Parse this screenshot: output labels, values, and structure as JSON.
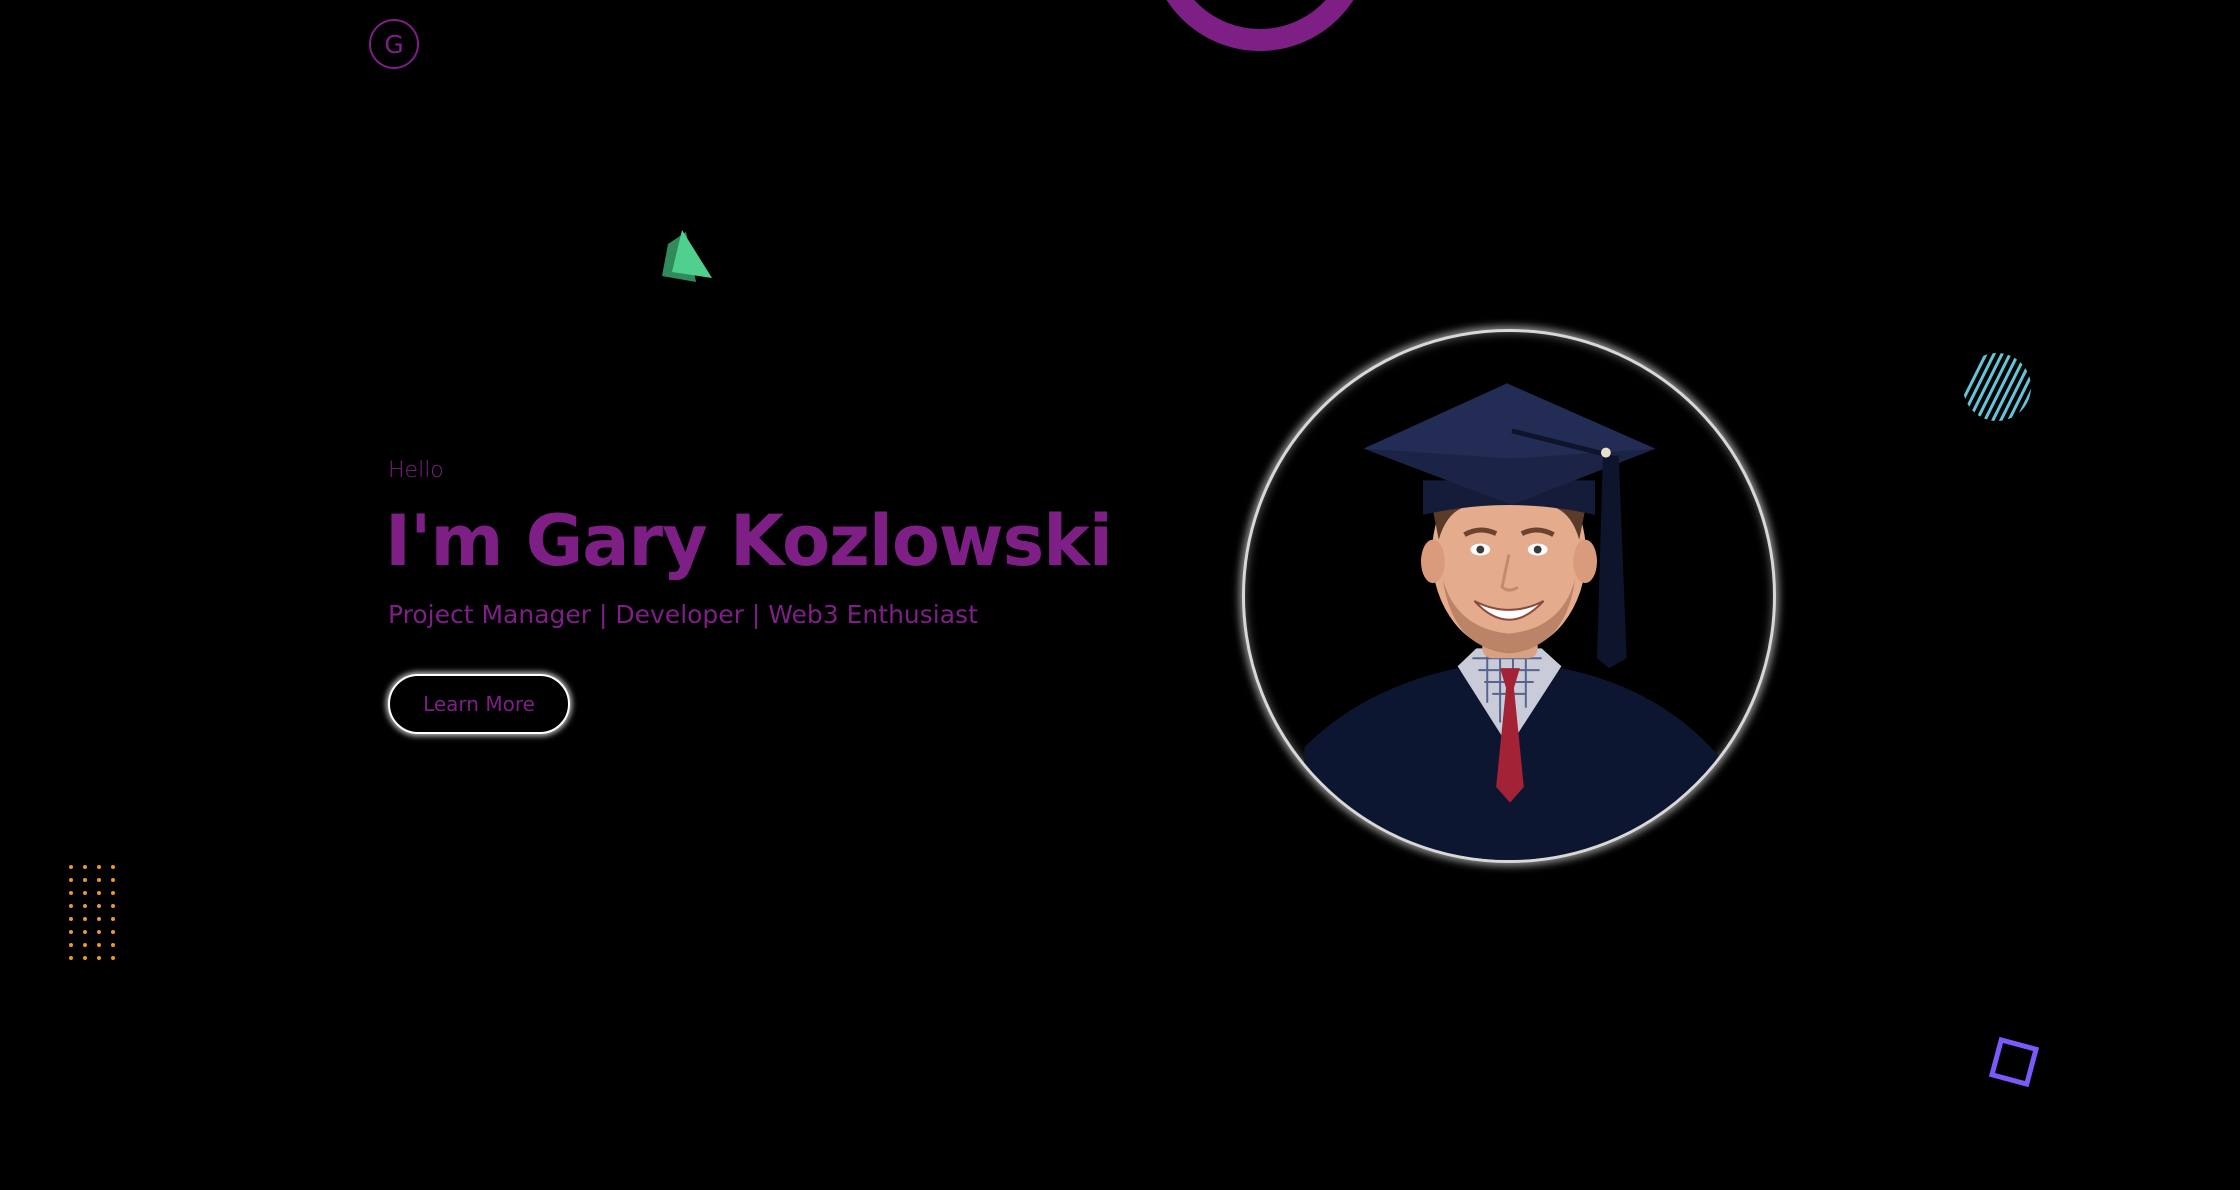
{
  "header": {
    "logo_letter": "G"
  },
  "hero": {
    "greeting": "Hello",
    "name": "I'm Gary Kozlowski",
    "tagline": "Project Manager | Developer | Web3 Enthusiast",
    "cta_label": "Learn More"
  },
  "portrait": {
    "alt": "Gary Kozlowski graduation portrait"
  },
  "colors": {
    "accent_purple": "#7e1f86",
    "background": "#000000",
    "triangle_green": "#4fd08e",
    "stripe_blue": "#63c5d6",
    "dots_orange": "#e89a2b",
    "square_violet": "#7a5af8"
  },
  "decor": {
    "icons": [
      "ring-shape",
      "triangle-shape",
      "striped-circle-shape",
      "dot-grid-shape",
      "square-shape"
    ]
  }
}
